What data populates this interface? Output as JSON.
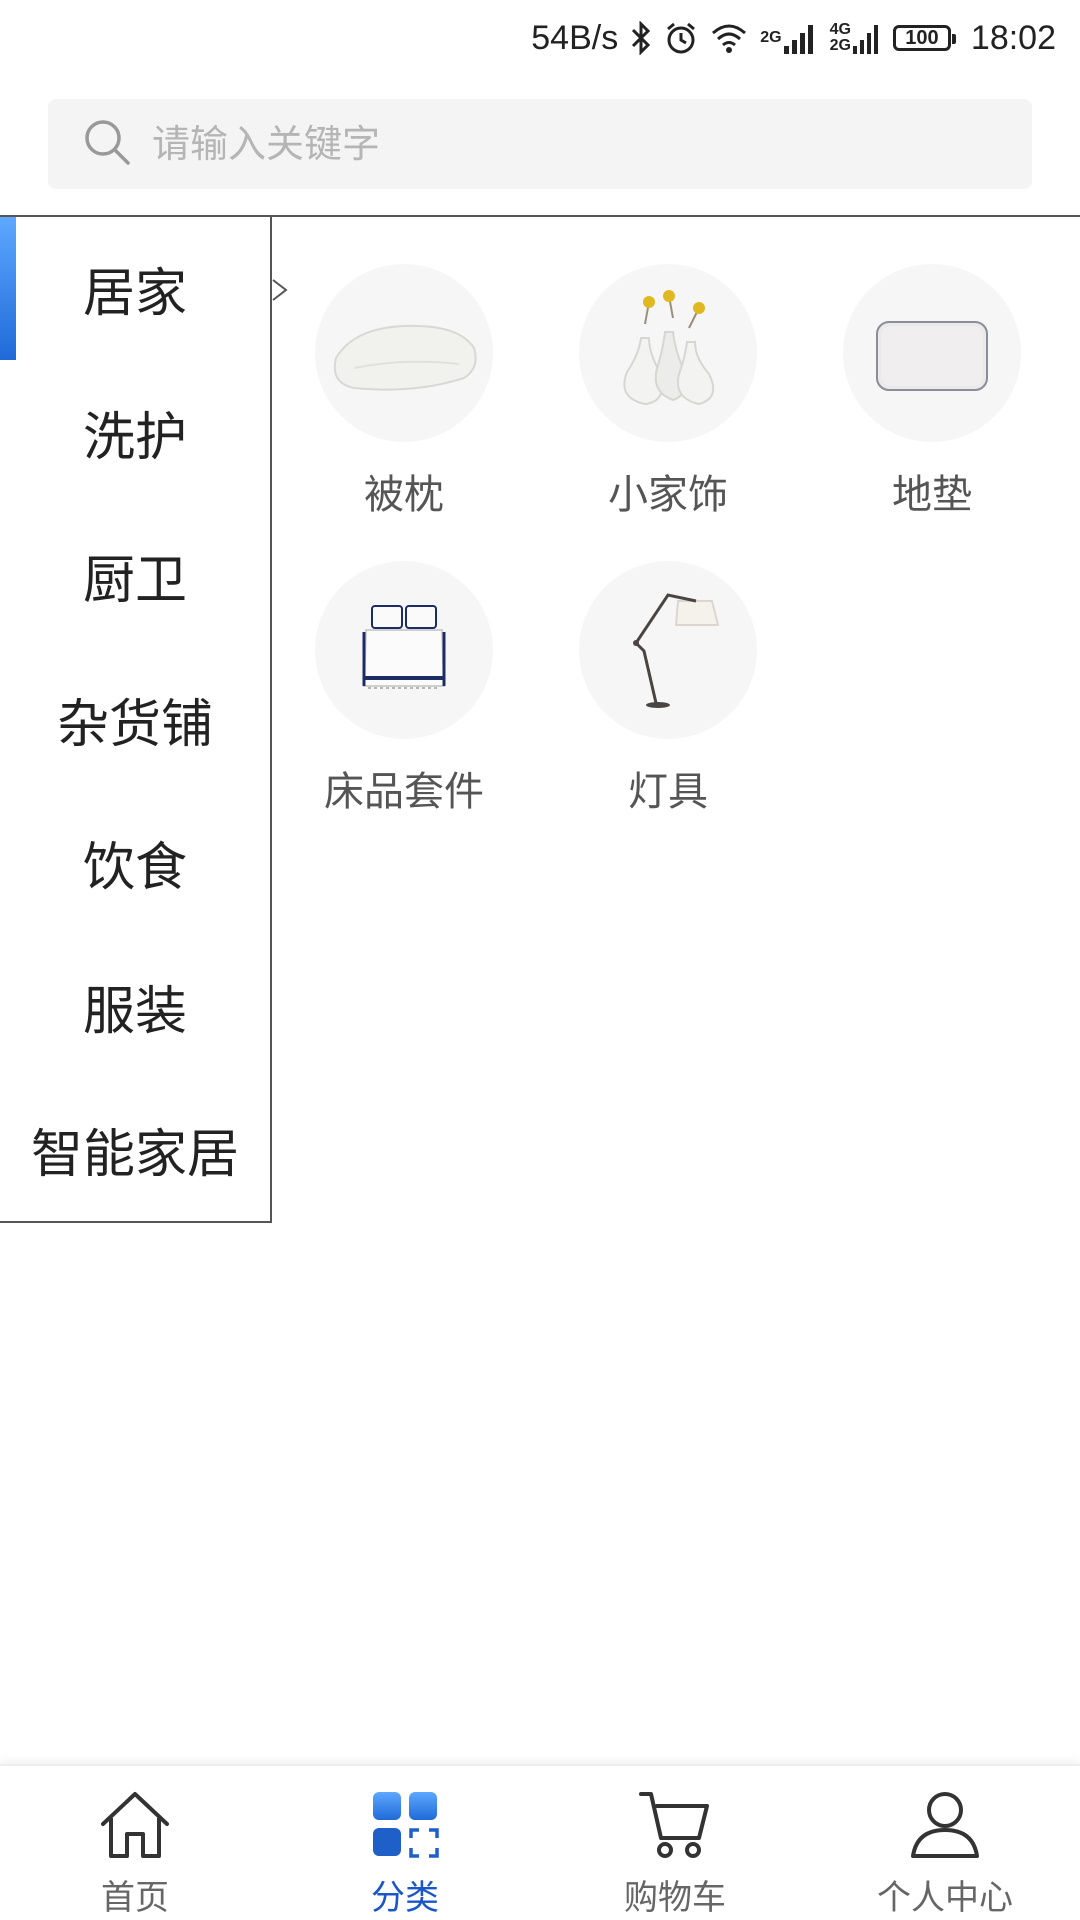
{
  "status_bar": {
    "net_speed": "54B/s",
    "net_2g": "2G",
    "net_4g": "4G",
    "net_2g_b": "2G",
    "battery": "100",
    "time": "18:02"
  },
  "search": {
    "placeholder": "请输入关键字",
    "value": ""
  },
  "sidebar": {
    "active_index": 0,
    "items": [
      {
        "label": "居家"
      },
      {
        "label": "洗护"
      },
      {
        "label": "厨卫"
      },
      {
        "label": "杂货铺"
      },
      {
        "label": "饮食"
      },
      {
        "label": "服装"
      },
      {
        "label": "智能家居"
      }
    ]
  },
  "categories": [
    {
      "label": "被枕",
      "icon": "pillow-image"
    },
    {
      "label": "小家饰",
      "icon": "vases-image"
    },
    {
      "label": "地垫",
      "icon": "floor-mat-image"
    },
    {
      "label": "床品套件",
      "icon": "bedding-set-image"
    },
    {
      "label": "灯具",
      "icon": "floor-lamp-image"
    }
  ],
  "bottom_nav": {
    "active_index": 1,
    "items": [
      {
        "label": "首页",
        "icon": "home-icon"
      },
      {
        "label": "分类",
        "icon": "category-grid-icon"
      },
      {
        "label": "购物车",
        "icon": "cart-icon"
      },
      {
        "label": "个人中心",
        "icon": "user-icon"
      }
    ]
  },
  "colors": {
    "accent": "#1a56c8",
    "accent_light": "#5ea8ff",
    "search_bg": "#f4f4f4"
  }
}
